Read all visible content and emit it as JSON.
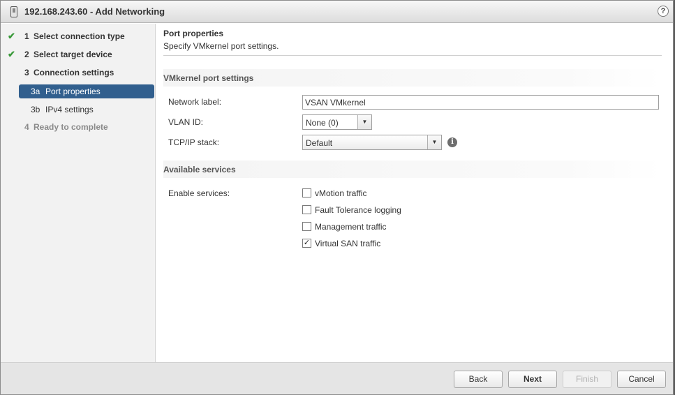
{
  "window": {
    "title": "192.168.243.60 - Add Networking",
    "help_symbol": "?"
  },
  "sidebar": {
    "check_symbol": "✔",
    "steps": [
      {
        "number": "1",
        "label": "Select connection type",
        "state": "done"
      },
      {
        "number": "2",
        "label": "Select target device",
        "state": "done"
      },
      {
        "number": "3",
        "label": "Connection settings",
        "state": "current"
      },
      {
        "number": "4",
        "label": "Ready to complete",
        "state": "disabled"
      }
    ],
    "substeps": [
      {
        "number": "3a",
        "label": "Port properties",
        "active": true
      },
      {
        "number": "3b",
        "label": "IPv4 settings",
        "active": false
      }
    ]
  },
  "content": {
    "title": "Port properties",
    "subtitle": "Specify VMkernel port settings.",
    "section_port": "VMkernel port settings",
    "network_label_label": "Network label:",
    "network_label_value": "VSAN VMkernel",
    "vlan_label": "VLAN ID:",
    "vlan_value": "None (0)",
    "tcpip_label": "TCP/IP stack:",
    "tcpip_value": "Default",
    "info_symbol": "i",
    "dropdown_arrow": "▼",
    "section_services": "Available services",
    "enable_services_label": "Enable services:",
    "services": [
      {
        "label": "vMotion traffic",
        "checked": false
      },
      {
        "label": "Fault Tolerance logging",
        "checked": false
      },
      {
        "label": "Management traffic",
        "checked": false
      },
      {
        "label": "Virtual SAN traffic",
        "checked": true
      }
    ],
    "check_mark": "✓"
  },
  "footer": {
    "back": "Back",
    "next": "Next",
    "finish": "Finish",
    "cancel": "Cancel"
  },
  "colors": {
    "active_step_bg": "#315f8e",
    "check_green": "#3a9a3a"
  }
}
